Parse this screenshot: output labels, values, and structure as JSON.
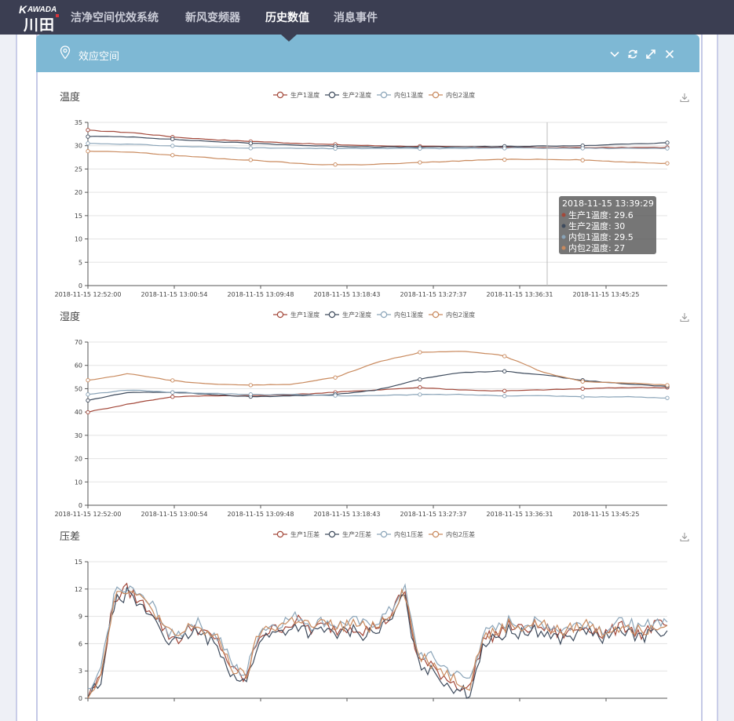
{
  "app": {
    "logo_en": "AWADA",
    "logo_k": "K",
    "logo_cn": "川田"
  },
  "nav": {
    "items": [
      {
        "label": "洁净空间优效系统",
        "active": false
      },
      {
        "label": "新风变频器",
        "active": false
      },
      {
        "label": "历史数值",
        "active": true
      },
      {
        "label": "消息事件",
        "active": false
      }
    ]
  },
  "panel": {
    "title": "效应空间",
    "icons": [
      "chevron-down-icon",
      "refresh-icon",
      "expand-icon",
      "close-icon"
    ]
  },
  "colors": {
    "nav_bg": "#3b3e52",
    "panel_header": "#7eb8d4",
    "series1": "#a3483a",
    "series2": "#3d4a5c",
    "series3": "#8aa4b8",
    "series4": "#c98a5e"
  },
  "chart_data": [
    {
      "type": "line",
      "title": "温度",
      "legend": [
        "生产1温度",
        "生产2温度",
        "内包1温度",
        "内包2温度"
      ],
      "legend_position": "top-center",
      "x_ticks": [
        "2018-11-15 12:52:00",
        "2018-11-15 13:00:54",
        "2018-11-15 13:09:48",
        "2018-11-15 13:18:43",
        "2018-11-15 13:27:37",
        "2018-11-15 13:36:31",
        "2018-11-15 13:45:25"
      ],
      "ylim": [
        0,
        35
      ],
      "y_ticks": [
        0,
        5,
        10,
        15,
        20,
        25,
        30,
        35
      ],
      "grid": true,
      "series": [
        {
          "name": "生产1温度",
          "values": [
            33.3,
            32.8,
            31.8,
            31.2,
            30.8,
            30.4,
            30.1,
            29.9,
            29.8,
            29.7,
            29.6,
            29.6,
            29.6,
            29.6
          ]
        },
        {
          "name": "生产2温度",
          "values": [
            32.0,
            31.9,
            31.3,
            30.8,
            30.4,
            30.0,
            29.8,
            29.7,
            29.7,
            29.8,
            29.9,
            30.0,
            30.3,
            30.6
          ]
        },
        {
          "name": "内包1温度",
          "values": [
            30.5,
            30.3,
            29.9,
            29.6,
            29.5,
            29.4,
            29.4,
            29.4,
            29.4,
            29.5,
            29.5,
            29.5,
            29.4,
            29.4
          ]
        },
        {
          "name": "内包2温度",
          "values": [
            28.8,
            28.6,
            27.9,
            27.2,
            26.7,
            26.0,
            25.9,
            26.2,
            26.6,
            27.0,
            27.1,
            27.0,
            26.5,
            26.2
          ]
        }
      ],
      "tooltip": {
        "title": "2018-11-15 13:39:29",
        "rows": [
          "生产1温度: 29.6",
          "生产2温度: 30",
          "内包1温度: 29.5",
          "内包2温度: 27"
        ]
      }
    },
    {
      "type": "line",
      "title": "湿度",
      "legend": [
        "生产1湿度",
        "生产2湿度",
        "内包1湿度",
        "内包2湿度"
      ],
      "legend_position": "top-center",
      "x_ticks": [
        "2018-11-15 12:52:00",
        "2018-11-15 13:00:54",
        "2018-11-15 13:09:48",
        "2018-11-15 13:18:43",
        "2018-11-15 13:27:37",
        "2018-11-15 13:36:31",
        "2018-11-15 13:45:25"
      ],
      "ylim": [
        0,
        70
      ],
      "y_ticks": [
        0,
        10,
        20,
        30,
        40,
        50,
        60,
        70
      ],
      "grid": true,
      "series": [
        {
          "name": "生产1湿度",
          "values": [
            40.0,
            43.5,
            46.5,
            47.0,
            47.0,
            47.5,
            48.5,
            49.5,
            50.5,
            49.5,
            49.0,
            49.5,
            50.0,
            50.5,
            50.5
          ]
        },
        {
          "name": "生产2湿度",
          "values": [
            45.0,
            48.5,
            48.5,
            47.5,
            46.5,
            47.0,
            47.5,
            49.5,
            54.0,
            57.0,
            57.5,
            56.0,
            53.5,
            52.0,
            51.0
          ]
        },
        {
          "name": "内包1湿度",
          "values": [
            47.5,
            49.5,
            48.5,
            48.0,
            47.5,
            47.5,
            47.0,
            47.0,
            47.5,
            47.5,
            47.0,
            47.0,
            46.5,
            46.5,
            46.0
          ]
        },
        {
          "name": "内包2湿度",
          "values": [
            53.5,
            56.5,
            53.5,
            52.0,
            51.5,
            52.0,
            55.0,
            61.5,
            65.5,
            66.0,
            64.5,
            57.0,
            53.0,
            52.5,
            51.5
          ]
        }
      ]
    },
    {
      "type": "line",
      "title": "压差",
      "legend": [
        "生产1压差",
        "生产2压差",
        "内包1压差",
        "内包2压差"
      ],
      "legend_position": "top-center",
      "ylim": [
        0,
        15
      ],
      "y_ticks": [
        0,
        3,
        6,
        9,
        12,
        15
      ],
      "grid": true,
      "series": [
        {
          "name": "生产1压差",
          "values": [
            0.2,
            2.5,
            11,
            12,
            10.5,
            9.5,
            7,
            6.5,
            8,
            7,
            6,
            3,
            2,
            7,
            7.5,
            8,
            8.5,
            7.5,
            8,
            7.5,
            8,
            7.5,
            8,
            9,
            12,
            4.5,
            3.5,
            2.5,
            1.5,
            1,
            6.5,
            7,
            8,
            7.5,
            8,
            7.5,
            7,
            7.5,
            8,
            7,
            7.5,
            8,
            7,
            8,
            8
          ]
        },
        {
          "name": "生产2压差",
          "values": [
            0.0,
            2.0,
            10.5,
            11.5,
            10,
            9,
            6.5,
            6,
            7.5,
            6.5,
            5.5,
            2.5,
            1.5,
            6.5,
            7,
            7.5,
            8,
            7,
            7.5,
            7,
            7.5,
            7,
            7.5,
            8.5,
            11.5,
            4,
            3,
            2,
            1,
            0.5,
            6,
            6.5,
            7.5,
            7,
            7.5,
            7,
            6.5,
            7,
            7.5,
            6.5,
            7,
            7.5,
            6.5,
            7.5,
            7.5
          ]
        },
        {
          "name": "内包1压差",
          "values": [
            0.5,
            3.0,
            11.5,
            12.5,
            11,
            10,
            7.5,
            7,
            8.5,
            7.5,
            6.5,
            3.5,
            2.5,
            7.5,
            8,
            8.5,
            9,
            8,
            8.5,
            8,
            8.5,
            8,
            8.5,
            9.5,
            12.5,
            5,
            4.5,
            3.5,
            2.5,
            2,
            7,
            7.5,
            8.5,
            8,
            8.5,
            8,
            7.5,
            8,
            8.5,
            7.5,
            8,
            8.5,
            7.5,
            8.5,
            8.5
          ]
        },
        {
          "name": "内包2压差",
          "values": [
            0.3,
            2.8,
            11.2,
            12.2,
            10.8,
            9.8,
            7.2,
            6.8,
            8.2,
            7.2,
            6.2,
            3.2,
            2.2,
            7.2,
            7.8,
            8.2,
            8.8,
            7.8,
            8.2,
            7.8,
            8.2,
            7.8,
            8.2,
            9.2,
            12.2,
            4.8,
            4,
            3,
            2,
            1.5,
            6.8,
            7.2,
            8.2,
            7.8,
            8.2,
            7.8,
            7.2,
            7.8,
            8.2,
            7.2,
            7.8,
            8.2,
            7.2,
            8.2,
            8.2
          ]
        }
      ]
    }
  ]
}
